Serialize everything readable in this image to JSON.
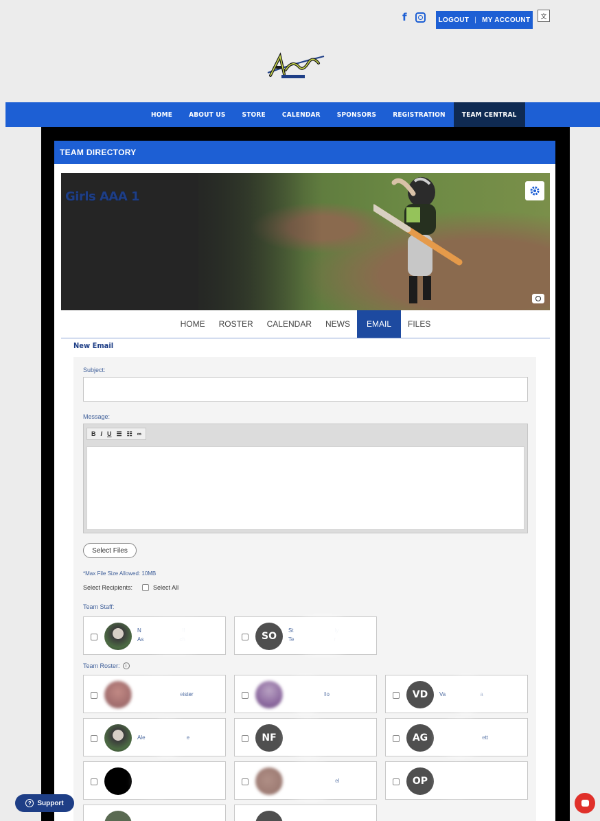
{
  "top": {
    "logout": "LOGOUT",
    "separator": "|",
    "my_account": "MY ACCOUNT"
  },
  "nav": {
    "items": [
      "HOME",
      "ABOUT US",
      "STORE",
      "CALENDAR",
      "SPONSORS",
      "REGISTRATION",
      "TEAM CENTRAL"
    ],
    "active": "TEAM CENTRAL"
  },
  "directory": {
    "title": "TEAM DIRECTORY"
  },
  "banner": {
    "team_name": "Girls AAA 1"
  },
  "tabs": [
    "HOME",
    "ROSTER",
    "CALENDAR",
    "NEWS",
    "EMAIL",
    "FILES"
  ],
  "active_tab": "EMAIL",
  "email": {
    "heading": "New Email",
    "subject_label": "Subject:",
    "message_label": "Message:",
    "toolbar": [
      "B",
      "I",
      "U",
      "☰",
      "☷",
      "∞"
    ],
    "select_files": "Select Files",
    "max_size": "*Max File Size Allowed: 10MB",
    "select_recipients": "Select Recipients:",
    "select_all": "Select All",
    "team_staff": "Team Staff:",
    "team_roster": "Team Roster:"
  },
  "staff": [
    {
      "initials": "",
      "line1": "N",
      "line1b": "ll",
      "line2": "As",
      "line2b": "ch"
    },
    {
      "initials": "SO",
      "line1": "St",
      "line1b": "ly",
      "line2": "Te",
      "line2b": "r"
    }
  ],
  "roster": [
    {
      "initials": "",
      "text": "eister"
    },
    {
      "initials": "",
      "text": "llo"
    },
    {
      "initials": "VD",
      "text": "Va",
      "text2": "a"
    },
    {
      "initials": "",
      "text": "Ale",
      "text2": "e"
    },
    {
      "initials": "NF",
      "text": ""
    },
    {
      "initials": "AG",
      "text": "",
      "text2": "ett"
    },
    {
      "initials": "",
      "text": ""
    },
    {
      "initials": "",
      "text": "el"
    },
    {
      "initials": "OP",
      "text": ""
    }
  ],
  "support": "Support",
  "colors": {
    "brand": "#1d5fd4",
    "dark": "#1e3e86",
    "nav_active": "#0f2a52"
  }
}
